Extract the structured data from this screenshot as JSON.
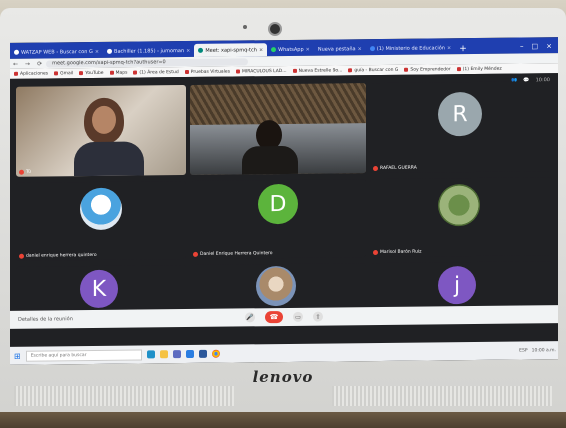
{
  "browser": {
    "tabs": [
      {
        "label": "WATZAP WEB - Buscar con G"
      },
      {
        "label": "Bachiller (1.185) - jumoman"
      },
      {
        "label": "Meet: xapi-spmq-tch",
        "active": true
      },
      {
        "label": "WhatsApp"
      },
      {
        "label": "Nueva pestaña"
      },
      {
        "label": "(1) Ministerio de Educación"
      }
    ],
    "new_tab": "+",
    "url": "meet.google.com/xapi-spmq-tch?authuser=0",
    "bookmarks": [
      "Aplicaciones",
      "Gmail",
      "YouTube",
      "Maps",
      "(1) Área de Estud",
      "Pruebas Virtuales",
      "MIRACULOUS LAD...",
      "Nueva Estrelle 9o...",
      "guía - Buscar con G",
      "Soy Emprendedor",
      "(1) Emily Méndez"
    ]
  },
  "meet": {
    "top_right_time": "10:00",
    "participants": [
      {
        "name": "Tú",
        "kind": "video"
      },
      {
        "name": "",
        "kind": "video"
      },
      {
        "name": "RAFAEL GUERRA",
        "kind": "avatar",
        "letter": "R",
        "color": "#9aa7ad"
      },
      {
        "name": "daniel enrique herrera quintero",
        "kind": "photo"
      },
      {
        "name": "Daniel Enrique Herrera Quintero",
        "kind": "avatar",
        "letter": "D",
        "color": "#5cb43c"
      },
      {
        "name": "Marisol Barón Ruiz",
        "kind": "photo"
      },
      {
        "name": "",
        "kind": "avatar",
        "letter": "K",
        "color": "#7e57c2"
      },
      {
        "name": "",
        "kind": "photo"
      },
      {
        "name": "",
        "kind": "avatar",
        "letter": "j",
        "color": "#7e57c2"
      }
    ],
    "meeting_code": "Detalles de la reunión",
    "end_call_icon": "phone-hangup-icon"
  },
  "taskbar": {
    "search_placeholder": "Escribe aquí para buscar",
    "tray_time": "10:00 a.m.",
    "tray_lang": "ESP"
  },
  "monitor": {
    "brand": "lenovo"
  }
}
